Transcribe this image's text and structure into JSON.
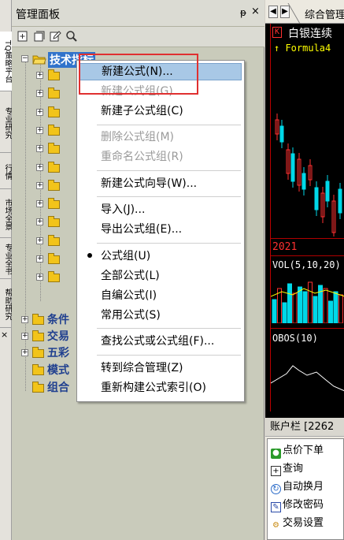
{
  "left_tabs": [
    "TQ策略平台",
    "专业研究",
    "行情",
    "市场全景",
    "专业全书",
    "帮助研究"
  ],
  "panel": {
    "title": "管理面板",
    "pin_glyph": "ᵽ",
    "close_glyph": "×"
  },
  "toolbar": {
    "icons": [
      "new-formula-icon",
      "new-group-icon",
      "edit-icon",
      "search-icon"
    ]
  },
  "tree": {
    "root": {
      "label": "技术指标",
      "expander": "−"
    },
    "collapsed_children_count": 12,
    "groups": [
      {
        "label": "条件",
        "expander": "+"
      },
      {
        "label": "交易",
        "expander": "+"
      },
      {
        "label": "五彩",
        "expander": "+"
      },
      {
        "label": "模式",
        "expander": ""
      },
      {
        "label": "组合",
        "expander": ""
      }
    ]
  },
  "context_menu": {
    "items": [
      {
        "label": "新建公式(N)...",
        "state": "highlighted"
      },
      {
        "label": "新建公式组(G)",
        "state": "disabled"
      },
      {
        "label": "新建子公式组(C)",
        "state": "normal"
      },
      {
        "label": "删除公式组(M)",
        "state": "disabled"
      },
      {
        "label": "重命名公式组(R)",
        "state": "disabled"
      },
      {
        "label": "新建公式向导(W)...",
        "state": "normal"
      },
      {
        "label": "导入(J)...",
        "state": "normal"
      },
      {
        "label": "导出公式组(E)...",
        "state": "normal"
      },
      {
        "label": "公式组(U)",
        "state": "checked"
      },
      {
        "label": "全部公式(L)",
        "state": "normal"
      },
      {
        "label": "自编公式(I)",
        "state": "normal"
      },
      {
        "label": "常用公式(S)",
        "state": "normal"
      },
      {
        "label": "查找公式或公式组(F)...",
        "state": "normal"
      },
      {
        "label": "转到综合管理(Z)",
        "state": "normal"
      },
      {
        "label": "重新构建公式索引(O)",
        "state": "normal"
      }
    ]
  },
  "right_panel": {
    "tab_label": "综合管理",
    "stock_title": "白银连续",
    "stock_badge": "K",
    "formula_label": "↑ Formula4",
    "year_label": "2021",
    "vol_label": "VOL(5,10,20)",
    "obos_label": "OBOS(10)",
    "colors": {
      "up": "#ff3030",
      "down": "#00d8e8",
      "axis": "#b00000",
      "yellow": "#ffff00"
    }
  },
  "account_bar": {
    "title": "账户栏 [2262",
    "items": [
      {
        "label": "点价下单",
        "icon": "green-order-icon"
      },
      {
        "label": "查询",
        "icon": "plus-box-icon"
      },
      {
        "label": "自动换月",
        "icon": "refresh-icon"
      },
      {
        "label": "修改密码",
        "icon": "edit-pencil-icon"
      },
      {
        "label": "交易设置",
        "icon": "gear-icon"
      }
    ]
  }
}
